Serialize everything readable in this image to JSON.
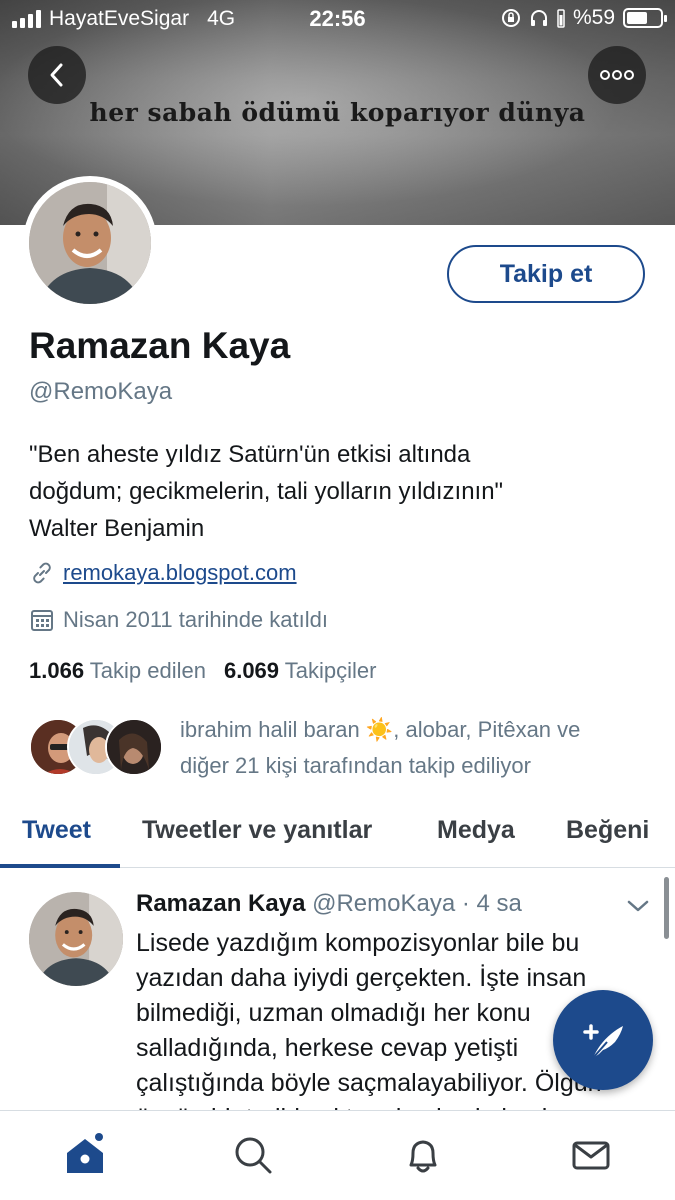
{
  "status_bar": {
    "carrier": "HayatEveSigar",
    "network": "4G",
    "time": "22:56",
    "battery": "%59"
  },
  "header": {
    "banner_quote": "her sabah ödümü koparıyor dünya",
    "back_icon": "chevron-left-icon",
    "more_icon": "more-options-icon"
  },
  "profile": {
    "name": "Ramazan Kaya",
    "handle": "@RemoKaya",
    "follow_label": "Takip et",
    "bio_lines": [
      "\"Ben aheste yıldız Satürn'ün etkisi altında",
      "doğdum; gecikmelerin, tali yolların yıldızının\"",
      "Walter Benjamin"
    ],
    "website": "remokaya.blogspot.com",
    "joined": "Nisan 2011 tarihinde katıldı",
    "following_count": "1.066",
    "following_label": "Takip edilen",
    "followers_count": "6.069",
    "followers_label": "Takipçiler",
    "followed_by_line1": "ibrahim halil baran ☀️, alobar, Pitêxan ve",
    "followed_by_line2": "diğer 21 kişi tarafından takip ediliyor"
  },
  "tabs": [
    {
      "label": "Tweet",
      "active": true
    },
    {
      "label": "Tweetler ve yanıtlar",
      "active": false
    },
    {
      "label": "Medya",
      "active": false
    },
    {
      "label": "Beğeni",
      "active": false
    }
  ],
  "tweet": {
    "name": "Ramazan Kaya",
    "handle": "@RemoKaya",
    "time": "· 4 sa",
    "lines": [
      "Lisede yazdığım kompozisyonlar bile bu",
      "yazıdan daha iyiydi gerçekten. İşte insan",
      "bilmediği, uzman olmadığı her konu",
      "salladığında, herkese cevap yetişti",
      "çalıştığında böyle saçmalayabiliyor. Ölgün",
      "özgün bir tarihi yoktur, devrimci akımlara"
    ]
  },
  "bottom_nav": {
    "items": [
      "home-icon",
      "search-icon",
      "notifications-icon",
      "messages-icon"
    ]
  },
  "colors": {
    "accent": "#1d4a8c",
    "secondary_text": "#657786",
    "primary_text": "#14171a"
  }
}
